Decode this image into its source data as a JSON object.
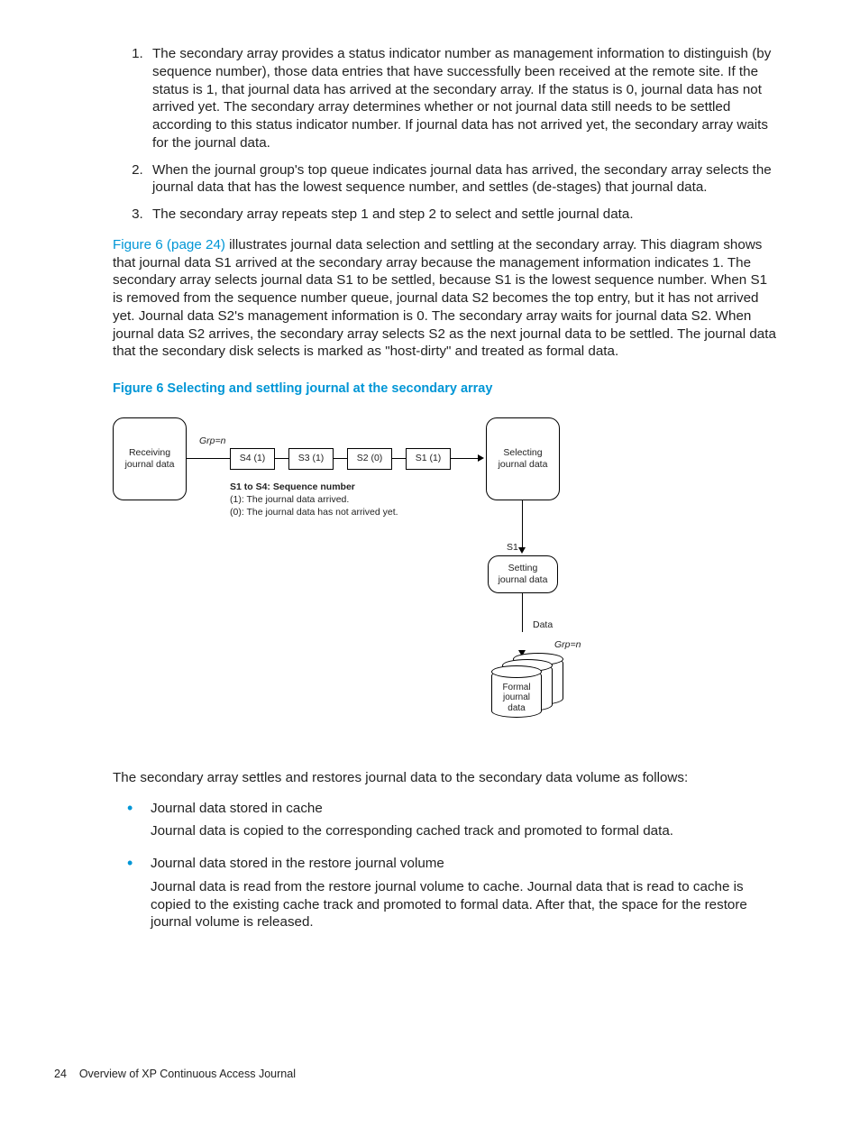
{
  "orderedList": [
    "The secondary array provides a status indicator number as management information to distinguish (by sequence number), those data entries that have successfully been received at the remote site. If the status is 1, that journal data has arrived at the secondary array. If the status is 0, journal data has not arrived yet. The secondary array determines whether or not journal data still needs to be settled according to this status indicator number. If journal data has not arrived yet, the secondary array waits for the journal data.",
    "When the journal group's top queue indicates journal data has arrived, the secondary array selects the journal data that has the lowest sequence number, and settles (de-stages) that journal data.",
    "The secondary array repeats step 1 and step 2 to select and settle journal data."
  ],
  "figLink": "Figure 6 (page 24)",
  "paraAfterList": " illustrates journal data selection and settling at the secondary array. This diagram shows that journal data S1 arrived at the secondary array because the management information indicates 1. The secondary array selects journal data S1 to be settled, because S1 is the lowest sequence number. When S1 is removed from the sequence number queue, journal data S2 becomes the top entry, but it has not arrived yet. Journal data S2's management information is 0. The secondary array waits for journal data S2. When journal data S2 arrives, the secondary array selects S2 as the next journal data to be settled. The journal data that the secondary disk selects is marked as \"host-dirty\" and treated as formal data.",
  "figCaption": "Figure 6 Selecting and settling journal at the secondary array",
  "diagram": {
    "receiving": "Receiving\njournal data",
    "grpTop": "Grp=n",
    "s4": "S4 (1)",
    "s3": "S3 (1)",
    "s2": "S2 (0)",
    "s1": "S1 (1)",
    "selecting": "Selecting\njournal data",
    "legendTitle": "S1 to S4: Sequence number",
    "legend1": "(1): The journal data arrived.",
    "legend0": "(0): The journal data has not arrived yet.",
    "s1lbl": "S1",
    "setting": "Setting\njournal data",
    "dataLbl": "Data",
    "grpBot": "Grp=n",
    "formal": "Formal\njournal\ndata"
  },
  "paraBeforeBullets": "The secondary array settles and restores journal data to the secondary data volume as follows:",
  "bullets": [
    {
      "head": "Journal data stored in cache",
      "body": "Journal data is copied to the corresponding cached track and promoted to formal data."
    },
    {
      "head": "Journal data stored in the restore journal volume",
      "body": "Journal data is read from the restore journal volume to cache. Journal data that is read to cache is copied to the existing cache track and promoted to formal data. After that, the space for the restore journal volume is released."
    }
  ],
  "footer": {
    "pageNum": "24",
    "title": "Overview of XP Continuous Access Journal"
  }
}
